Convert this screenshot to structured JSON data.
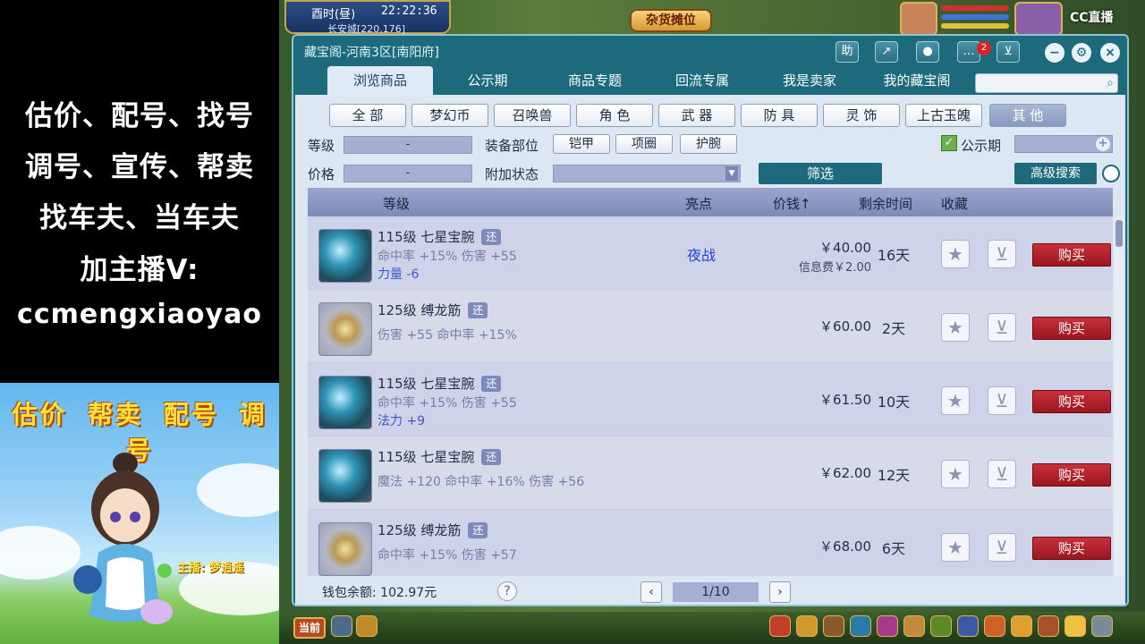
{
  "promo": {
    "line1": "估价、配号、找号",
    "line2": "调号、宣传、帮卖",
    "line3": "找车夫、当车夫",
    "line4": "加主播V:",
    "line5": "ccmengxiaoyao"
  },
  "banner": {
    "title": "估价 帮卖 配号 调号",
    "anchor": "主播: 梦逍遥"
  },
  "hud": {
    "time_label": "酉时(昼)",
    "clock": "22:22:36",
    "location": "长安城[220,176]",
    "market_sign": "杂货摊位",
    "brand": "CC直播",
    "now_button": "当前"
  },
  "window": {
    "title": "藏宝阁-河南3区[南阳府]",
    "help_label": "助",
    "mail_count": "2"
  },
  "main_tabs": [
    {
      "label": "浏览商品",
      "active": true
    },
    {
      "label": "公示期"
    },
    {
      "label": "商品专题"
    },
    {
      "label": "回流专属"
    },
    {
      "label": "我是卖家"
    },
    {
      "label": "我的藏宝阁"
    }
  ],
  "categories": [
    {
      "label": "全 部"
    },
    {
      "label": "梦幻币"
    },
    {
      "label": "召唤兽"
    },
    {
      "label": "角 色"
    },
    {
      "label": "武 器"
    },
    {
      "label": "防 具"
    },
    {
      "label": "灵 饰"
    },
    {
      "label": "上古玉魄"
    },
    {
      "label": "其 他",
      "active": true
    }
  ],
  "filters": {
    "level_label": "等级",
    "level_value": "-",
    "price_label": "价格",
    "price_value": "-",
    "slot_label": "装备部位",
    "slots": [
      "铠甲",
      "项圈",
      "护腕"
    ],
    "status_label": "附加状态",
    "filter_button": "筛选",
    "public_label": "公示期",
    "advanced_button": "高级搜索"
  },
  "table": {
    "headers": {
      "level": "等级",
      "highlight": "亮点",
      "price": "价钱↑",
      "time": "剩余时间",
      "fav": "收藏"
    },
    "rows": [
      {
        "name": "115级 七星宝腕",
        "tag": "还",
        "icon": "bracelet",
        "attr1": "命中率 +15% 伤害 +55",
        "attr2": "力量 -6",
        "highlight": "夜战",
        "price": "￥40.00",
        "fee": "信息费￥2.00",
        "time": "16天",
        "buy": "购买"
      },
      {
        "name": "125级 缚龙筋",
        "tag": "还",
        "icon": "tendon",
        "attr1": "伤害 +55 命中率 +15%",
        "attr2": "",
        "highlight": "",
        "price": "￥60.00",
        "fee": "",
        "time": "2天",
        "buy": "购买"
      },
      {
        "name": "115级 七星宝腕",
        "tag": "还",
        "icon": "bracelet",
        "attr1": "命中率 +15% 伤害 +55",
        "attr2": "法力 +9",
        "highlight": "",
        "price": "￥61.50",
        "fee": "",
        "time": "10天",
        "buy": "购买"
      },
      {
        "name": "115级 七星宝腕",
        "tag": "还",
        "icon": "bracelet",
        "attr1": "魔法 +120 命中率 +16% 伤害 +56",
        "attr2": "",
        "highlight": "",
        "price": "￥62.00",
        "fee": "",
        "time": "12天",
        "buy": "购买"
      },
      {
        "name": "125级 缚龙筋",
        "tag": "还",
        "icon": "tendon",
        "attr1": "命中率 +15% 伤害 +57",
        "attr2": "",
        "highlight": "",
        "price": "￥68.00",
        "fee": "",
        "time": "6天",
        "buy": "购买"
      }
    ]
  },
  "footer": {
    "wallet": "钱包余额: 102.97元",
    "help": "?",
    "page": "1/10"
  },
  "colors": {
    "window_teal": "#1c6a7c",
    "buy_red": "#b01e28",
    "highlight_blue": "#1f46d8"
  }
}
